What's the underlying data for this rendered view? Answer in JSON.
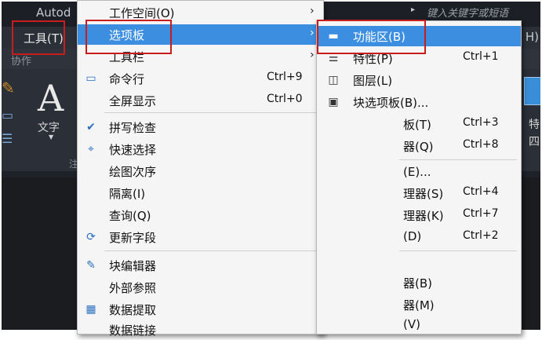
{
  "app": {
    "title_partial": "Autod",
    "search_placeholder": "键入关键字或短语",
    "search_arrow": "▸",
    "menubar_right_partial": "H)"
  },
  "menubar": {
    "tools_label": "工具(T)"
  },
  "ribbon": {
    "tab_partial": "协作",
    "text_label": "文字",
    "text_icon_glyph": "A",
    "panel_char": "注",
    "right_text1": "特",
    "right_text2": "四"
  },
  "main_menu": {
    "items": [
      {
        "label": "工作空间(O)",
        "shortcut": "",
        "submenu": true,
        "icon": "",
        "icon_name": ""
      },
      {
        "label": "选项板",
        "shortcut": "",
        "submenu": true,
        "icon": "",
        "icon_name": "",
        "highlighted": true
      },
      {
        "label": "工具栏",
        "shortcut": "",
        "submenu": true,
        "icon": "",
        "icon_name": ""
      },
      {
        "label": "命令行",
        "shortcut": "Ctrl+9",
        "submenu": false,
        "icon": "▭",
        "icon_name": "command-line-icon"
      },
      {
        "label": "全屏显示",
        "shortcut": "Ctrl+0",
        "submenu": false,
        "icon": "",
        "icon_name": ""
      },
      {
        "label": "拼写检查",
        "shortcut": "",
        "submenu": false,
        "icon": "✔",
        "icon_name": "spell-check-icon"
      },
      {
        "label": "快速选择",
        "shortcut": "",
        "submenu": false,
        "icon": "⌖",
        "icon_name": "quick-select-icon"
      },
      {
        "label": "绘图次序",
        "shortcut": "",
        "submenu": true,
        "icon": "",
        "icon_name": ""
      },
      {
        "label": "隔离(I)",
        "shortcut": "",
        "submenu": true,
        "icon": "",
        "icon_name": ""
      },
      {
        "label": "查询(Q)",
        "shortcut": "",
        "submenu": true,
        "icon": "",
        "icon_name": ""
      },
      {
        "label": "更新字段",
        "shortcut": "",
        "submenu": false,
        "icon": "⟳",
        "icon_name": "update-field-icon"
      },
      {
        "label": "块编辑器",
        "shortcut": "",
        "submenu": false,
        "icon": "✎",
        "icon_name": "block-editor-icon"
      },
      {
        "label": "外部参照",
        "shortcut": "",
        "submenu": false,
        "icon": "",
        "icon_name": ""
      },
      {
        "label": "数据提取",
        "shortcut": "",
        "submenu": false,
        "icon": "▦",
        "icon_name": "data-extraction-icon"
      },
      {
        "label": "数据链接",
        "shortcut": "",
        "submenu": false,
        "icon": "",
        "icon_name": ""
      }
    ],
    "arrow_glyph": "›"
  },
  "sub_menu": {
    "items": [
      {
        "label": "功能区(B)",
        "shortcut": "",
        "icon": "▬",
        "icon_name": "ribbon-icon",
        "highlighted": true
      },
      {
        "label": "特性(P)",
        "shortcut": "Ctrl+1",
        "icon": "☰",
        "icon_name": "properties-icon"
      },
      {
        "label": "图层(L)",
        "shortcut": "",
        "icon": "◫",
        "icon_name": "layers-icon"
      },
      {
        "label": "块选项板(B)...",
        "shortcut": "",
        "icon": "▣",
        "icon_name": "block-palette-icon"
      },
      {
        "label": "板(T)",
        "shortcut": "Ctrl+3",
        "icon": "",
        "icon_name": ""
      },
      {
        "label": "器(Q)",
        "shortcut": "Ctrl+8",
        "icon": "",
        "icon_name": ""
      },
      {
        "label": "(E)...",
        "shortcut": "",
        "icon": "",
        "icon_name": ""
      },
      {
        "label": "理器(S)",
        "shortcut": "Ctrl+4",
        "icon": "",
        "icon_name": ""
      },
      {
        "label": "理器(K)",
        "shortcut": "Ctrl+7",
        "icon": "",
        "icon_name": ""
      },
      {
        "label": "(D)",
        "shortcut": "Ctrl+2",
        "icon": "",
        "icon_name": ""
      },
      {
        "label": "器(B)",
        "shortcut": "",
        "icon": "",
        "icon_name": ""
      },
      {
        "label": "器(M)",
        "shortcut": "",
        "icon": "",
        "icon_name": ""
      },
      {
        "label": "(V)",
        "shortcut": "",
        "icon": "",
        "icon_name": ""
      }
    ]
  }
}
